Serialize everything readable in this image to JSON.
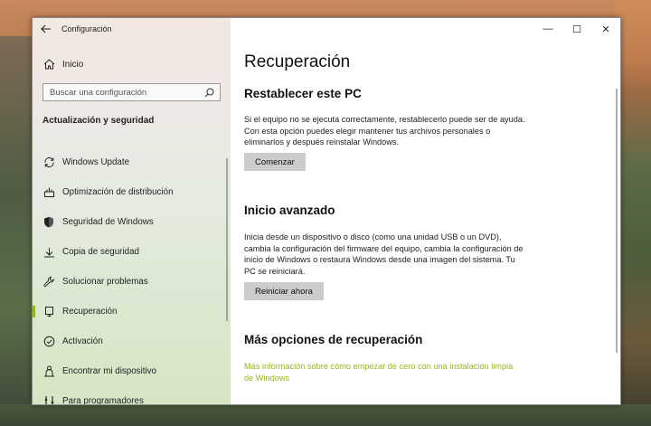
{
  "window": {
    "app_title": "Configuración",
    "controls": {
      "minimize": "—",
      "maximize": "☐",
      "close": "✕"
    }
  },
  "sidebar": {
    "home_label": "Inicio",
    "search_placeholder": "Buscar una configuración",
    "section_heading": "Actualización y seguridad",
    "items": [
      {
        "label": "Windows Update",
        "icon": "sync-icon"
      },
      {
        "label": "Optimización de distribución",
        "icon": "delivery-optimization-icon"
      },
      {
        "label": "Seguridad de Windows",
        "icon": "shield-icon"
      },
      {
        "label": "Copia de seguridad",
        "icon": "backup-arrow-icon"
      },
      {
        "label": "Solucionar problemas",
        "icon": "wrench-icon"
      },
      {
        "label": "Recuperación",
        "icon": "recovery-icon",
        "selected": true
      },
      {
        "label": "Activación",
        "icon": "check-circle-icon"
      },
      {
        "label": "Encontrar mi dispositivo",
        "icon": "person-locate-icon"
      },
      {
        "label": "Para programadores",
        "icon": "developer-icon"
      }
    ]
  },
  "main": {
    "page_title": "Recuperación",
    "reset": {
      "heading": "Restablecer este PC",
      "description": "Si el equipo no se ejecuta correctamente, restablecerlo puede ser de ayuda. Con esta opción puedes elegir mantener tus archivos personales o eliminarlos y después reinstalar Windows.",
      "button": "Comenzar"
    },
    "advanced": {
      "heading": "Inicio avanzado",
      "description": "Inicia desde un dispositivo o disco (como una unidad USB o un DVD), cambia la configuración del firmware del equipo, cambia la configuración de inicio de Windows o restaura Windows desde una imagen del sistema. Tu PC se reiniciará.",
      "button": "Reiniciar ahora"
    },
    "more": {
      "heading": "Más opciones de recuperación",
      "link": "Más información sobre cómo empezar de cero con una instalación limpia de Windows"
    }
  },
  "colors": {
    "accent": "#9ab51e",
    "button_bg": "#cccccc"
  }
}
